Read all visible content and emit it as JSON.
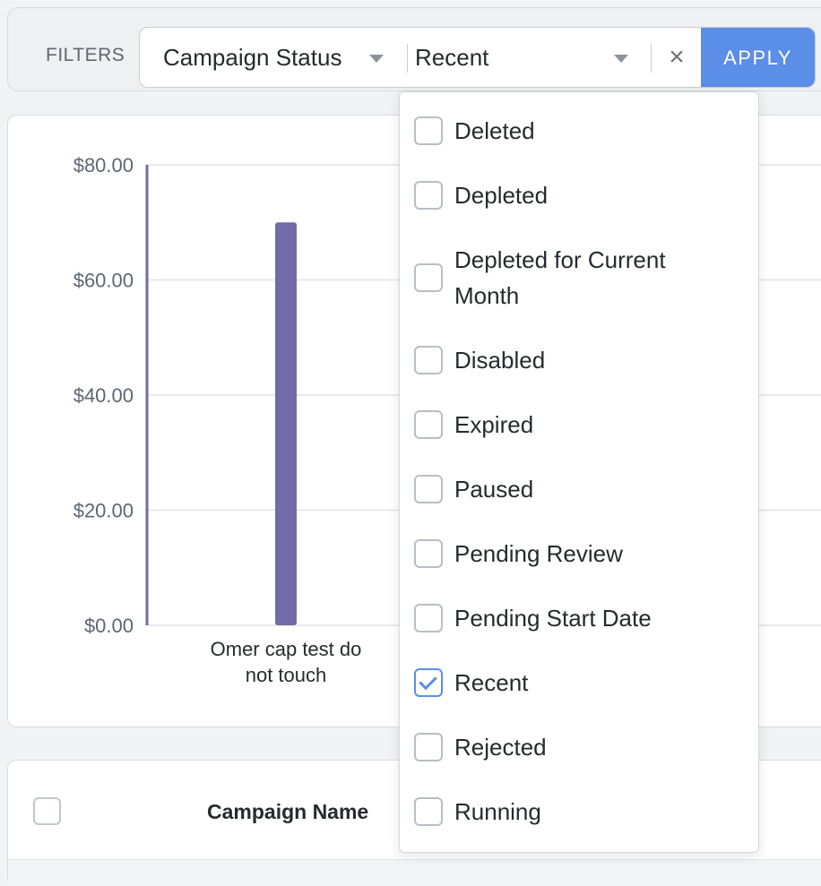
{
  "filters": {
    "label": "FILTERS",
    "field": "Campaign Status",
    "value": "Recent",
    "clear_icon": "×",
    "apply_label": "APPLY"
  },
  "chart_data": {
    "type": "bar",
    "categories": [
      "Omer cap test do not touch"
    ],
    "category_lines": [
      [
        "Omer cap test do",
        "not touch"
      ]
    ],
    "values": [
      70
    ],
    "ylim": [
      0,
      80
    ],
    "yticks": [
      0,
      20,
      40,
      60,
      80
    ],
    "ytick_labels": [
      "$0.00",
      "$20.00",
      "$40.00",
      "$60.00",
      "$80.00"
    ],
    "grid": true,
    "bar_color": "#726ba5",
    "axis_color": "#726ba5"
  },
  "table": {
    "columns": [
      "Campaign Name"
    ]
  },
  "dropdown": {
    "options": [
      {
        "lines": [
          "Deleted"
        ],
        "checked": false
      },
      {
        "lines": [
          "Depleted"
        ],
        "checked": false
      },
      {
        "lines": [
          "Depleted for Current",
          "Month"
        ],
        "checked": false
      },
      {
        "lines": [
          "Disabled"
        ],
        "checked": false
      },
      {
        "lines": [
          "Expired"
        ],
        "checked": false
      },
      {
        "lines": [
          "Paused"
        ],
        "checked": false
      },
      {
        "lines": [
          "Pending Review"
        ],
        "checked": false
      },
      {
        "lines": [
          "Pending Start Date"
        ],
        "checked": false
      },
      {
        "lines": [
          "Recent"
        ],
        "checked": true
      },
      {
        "lines": [
          "Rejected"
        ],
        "checked": false
      },
      {
        "lines": [
          "Running"
        ],
        "checked": false
      }
    ]
  },
  "colors": {
    "accent": "#5b8ee6",
    "bar": "#726ba5"
  }
}
